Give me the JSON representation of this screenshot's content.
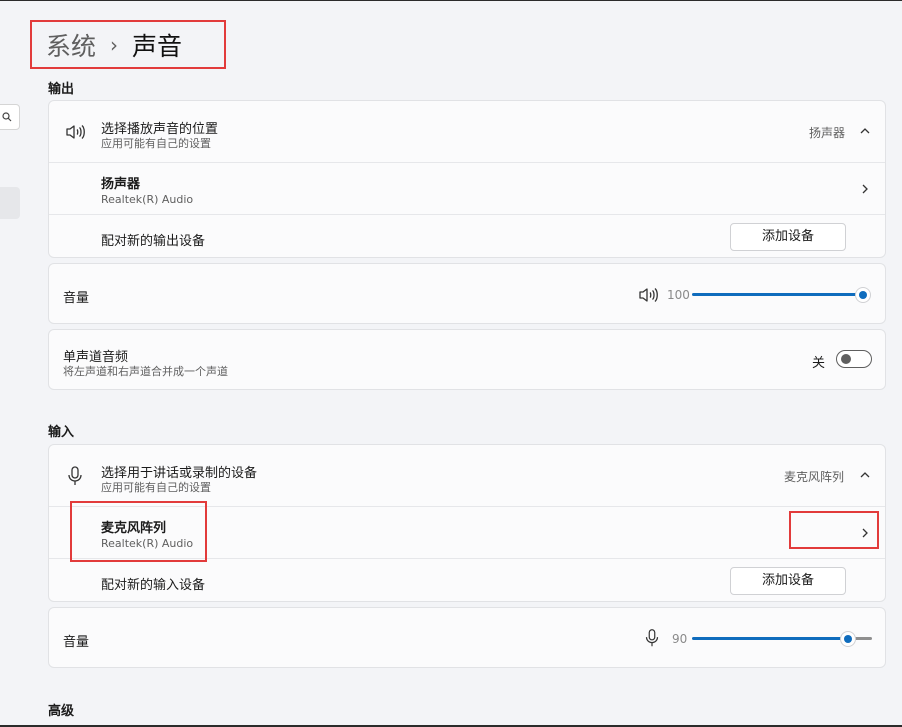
{
  "breadcrumb": {
    "parent": "系统",
    "separator": "›",
    "current": "声音"
  },
  "output": {
    "section_label": "输出",
    "choose_device": {
      "title": "选择播放声音的位置",
      "subtitle": "应用可能有自己的设置",
      "value": "扬声器"
    },
    "device": {
      "name": "扬声器",
      "driver": "Realtek(R) Audio"
    },
    "pair": {
      "label": "配对新的输出设备",
      "button": "添加设备"
    },
    "volume": {
      "label": "音量",
      "value": "100",
      "level_percent": 100
    },
    "mono": {
      "title": "单声道音频",
      "subtitle": "将左声道和右声道合并成一个声道",
      "state": "关"
    }
  },
  "input": {
    "section_label": "输入",
    "choose_device": {
      "title": "选择用于讲话或录制的设备",
      "subtitle": "应用可能有自己的设置",
      "value": "麦克风阵列"
    },
    "device": {
      "name": "麦克风阵列",
      "driver": "Realtek(R) Audio"
    },
    "pair": {
      "label": "配对新的输入设备",
      "button": "添加设备"
    },
    "volume": {
      "label": "音量",
      "value": "90",
      "level_percent": 90
    }
  },
  "advanced": {
    "section_label": "高级"
  },
  "colors": {
    "accent": "#0f6cbd",
    "highlight": "#e23b3b",
    "background": "#f3f4f7"
  },
  "icons": [
    "search-icon",
    "speaker-icon",
    "microphone-icon",
    "chevron-up-icon",
    "chevron-right-icon"
  ]
}
